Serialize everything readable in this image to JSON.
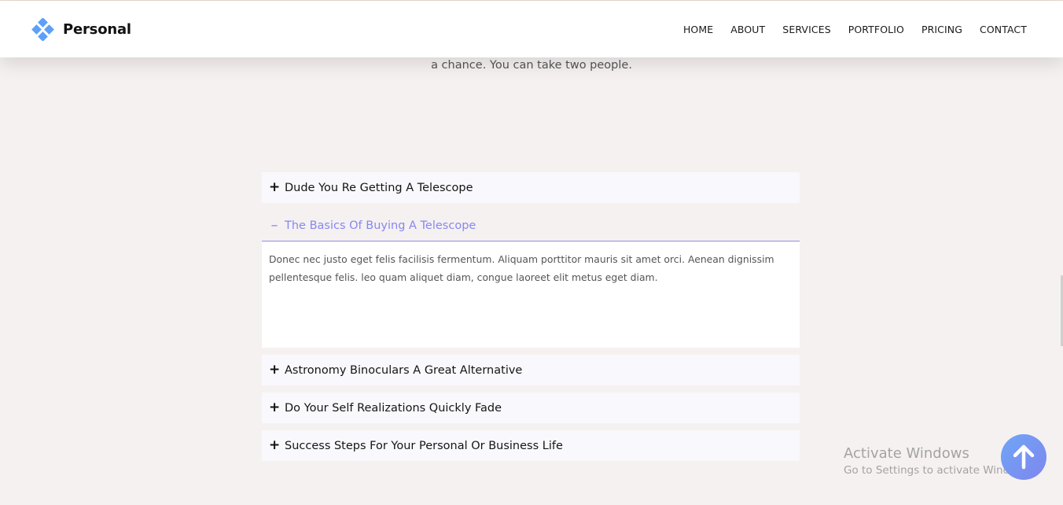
{
  "brand": {
    "name": "Personal",
    "accent": "#8588f1",
    "logo_color": "#5ea0f5"
  },
  "nav": {
    "items": [
      {
        "label": "HOME"
      },
      {
        "label": "ABOUT"
      },
      {
        "label": "SERVICES"
      },
      {
        "label": "PORTFOLIO"
      },
      {
        "label": "PRICING"
      },
      {
        "label": "CONTACT"
      }
    ]
  },
  "intro_text": "a chance. You can take two people.",
  "accordion": {
    "items": [
      {
        "title": "Dude You Re Getting A Telescope",
        "icon": "plus-icon",
        "open": false
      },
      {
        "title": "The Basics Of Buying A Telescope",
        "icon": "minus-icon",
        "open": true,
        "body": "Donec nec justo eget felis facilisis fermentum. Aliquam porttitor mauris sit amet orci. Aenean dignissim pellentesque felis. leo quam aliquet diam, congue laoreet elit metus eget diam."
      },
      {
        "title": "Astronomy Binoculars A Great Alternative",
        "icon": "plus-icon",
        "open": false
      },
      {
        "title": "Do Your Self Realizations Quickly Fade",
        "icon": "plus-icon",
        "open": false
      },
      {
        "title": "Success Steps For Your Personal Or Business Life",
        "icon": "plus-icon",
        "open": false
      }
    ]
  },
  "watermark": {
    "title": "Activate Windows",
    "subtitle": "Go to Settings to activate Windows."
  },
  "scroll_top": {
    "icon": "arrow-up-icon"
  }
}
